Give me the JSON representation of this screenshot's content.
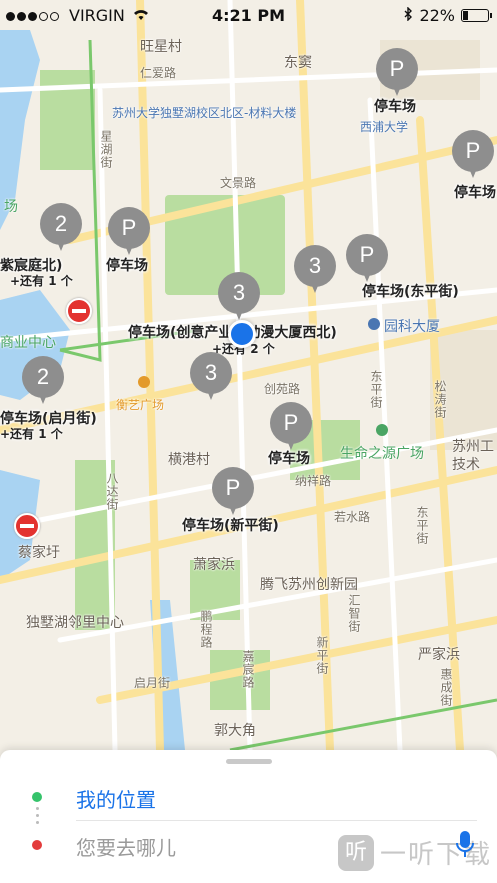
{
  "status": {
    "carrier": "VIRGIN",
    "time": "4:21 PM",
    "battery": "22%"
  },
  "map": {
    "place_labels": {
      "wangxingcun": "旺星村",
      "renaixu": "仁爱路",
      "dongji": "东窦",
      "suzhou_univ": "苏州大学独墅湖校区北区-材料大楼",
      "xipu_univ": "西浦大学",
      "huanghu_street": "星湖街",
      "wenjing_road": "文景路",
      "chuangyuan_road": "创苑路",
      "hengang_cun": "横港村",
      "dongping_street_v": "东平街",
      "songtao_street": "松涛街",
      "naxiang_road": "纳祥路",
      "ruoshui_road": "若水路",
      "dongping_street2": "东平街",
      "xiaojia_bang": "萧家浜",
      "tengfei": "腾飞苏州创新园",
      "caijiayu": "蔡家圩",
      "dushuhu_center": "独墅湖邻里中心",
      "pengcheng_road": "鹏程路",
      "huijin_road": "汇智街",
      "qiyue_street": "启月街",
      "jiachen_road": "嘉宸路",
      "xinping_street_v": "新平街",
      "yanjia_bang": "严家浜",
      "huicheng_street": "惠成街",
      "guodajiao": "郭大角",
      "bagu_street": "八达街",
      "suzhou_gong": "苏州工",
      "jishu": "技术",
      "guangchang": "场",
      "shangye_center": "商业中心",
      "yuanli_tower": "园科大厦",
      "hengyi_square": "衡艺广场",
      "shengming_square": "生命之源广场"
    },
    "parking_pins": [
      {
        "glyph": "P",
        "label": "停车场"
      },
      {
        "glyph": "P",
        "label": "停车场"
      },
      {
        "glyph": "P",
        "label": "停车场(东平街)"
      },
      {
        "glyph": "P",
        "label": "停车场"
      },
      {
        "glyph": "P",
        "label": "停车场(新平街)"
      },
      {
        "glyph": "P",
        "label": "停车场"
      }
    ],
    "cluster_pins": [
      {
        "count": "2",
        "label": "紫宸庭北)",
        "sub": "+还有 1 个"
      },
      {
        "count": "3",
        "label": "",
        "sub": ""
      },
      {
        "count": "3",
        "label": "停车场(创意产业园动漫大厦西北)",
        "sub": "+还有 2 个"
      },
      {
        "count": "3",
        "label": "",
        "sub": ""
      },
      {
        "count": "2",
        "label": "停车场(启月街)",
        "sub": "+还有 1 个"
      }
    ]
  },
  "panel": {
    "origin": "我的位置",
    "destination_placeholder": "您要去哪儿",
    "watermark": "一听下载"
  },
  "colors": {
    "accent": "#1a73e8",
    "origin_dot": "#35c36b",
    "dest_dot": "#e33b3b",
    "pin": "#8e8e8e"
  }
}
